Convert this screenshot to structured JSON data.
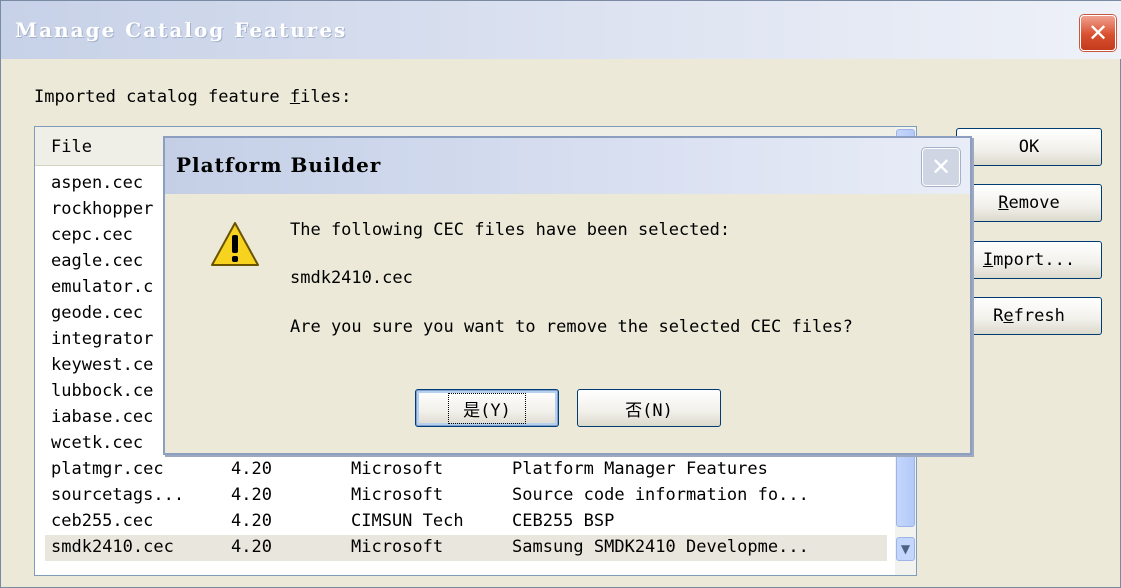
{
  "window": {
    "title": "Manage Catalog Features"
  },
  "label": {
    "before": "Imported catalog feature ",
    "underline": "f",
    "after": "iles:"
  },
  "list": {
    "header": "File",
    "rows": [
      {
        "file": "aspen.cec",
        "version": "",
        "vendor": "",
        "description": ""
      },
      {
        "file": "rockhopper",
        "version": "",
        "vendor": "",
        "description": ""
      },
      {
        "file": "cepc.cec",
        "version": "",
        "vendor": "",
        "description": ""
      },
      {
        "file": "eagle.cec",
        "version": "",
        "vendor": "",
        "description": ""
      },
      {
        "file": "emulator.c",
        "version": "",
        "vendor": "",
        "description": ""
      },
      {
        "file": "geode.cec",
        "version": "",
        "vendor": "",
        "description": ""
      },
      {
        "file": "integrator",
        "version": "",
        "vendor": "",
        "description": ""
      },
      {
        "file": "keywest.ce",
        "version": "",
        "vendor": "",
        "description": ""
      },
      {
        "file": "lubbock.ce",
        "version": "",
        "vendor": "",
        "description": ""
      },
      {
        "file": "iabase.cec",
        "version": "",
        "vendor": "",
        "description": ""
      },
      {
        "file": "wcetk.cec",
        "version": "",
        "vendor": "",
        "description": ""
      },
      {
        "file": "platmgr.cec",
        "version": "4.20",
        "vendor": "Microsoft",
        "description": "Platform Manager Features"
      },
      {
        "file": "sourcetags...",
        "version": "4.20",
        "vendor": "Microsoft",
        "description": "Source code information fo..."
      },
      {
        "file": "ceb255.cec",
        "version": "4.20",
        "vendor": "CIMSUN Tech",
        "description": "CEB255 BSP"
      },
      {
        "file": "smdk2410.cec",
        "version": "4.20",
        "vendor": "Microsoft",
        "description": "Samsung SMDK2410 Developme..."
      }
    ]
  },
  "buttons": {
    "ok": "OK",
    "remove": {
      "before": "",
      "underline": "R",
      "after": "emove"
    },
    "import": {
      "before": "",
      "underline": "I",
      "after": "mport..."
    },
    "refresh": {
      "before": "R",
      "underline": "e",
      "after": "fresh"
    }
  },
  "dialog": {
    "title": "Platform Builder",
    "line1": "The following CEC files have been selected:",
    "line2": "smdk2410.cec",
    "line3": "Are you sure you want to remove the selected CEC files?",
    "yes": "是(Y)",
    "no": "否(N)"
  },
  "icons": {
    "warning": "warning-icon",
    "close": "close-icon",
    "scroll_down": "chevron-down-icon"
  },
  "colors": {
    "close_red": "#d9502f",
    "selection": "#e9e7dd",
    "dialog_bg": "#ece9d8"
  }
}
